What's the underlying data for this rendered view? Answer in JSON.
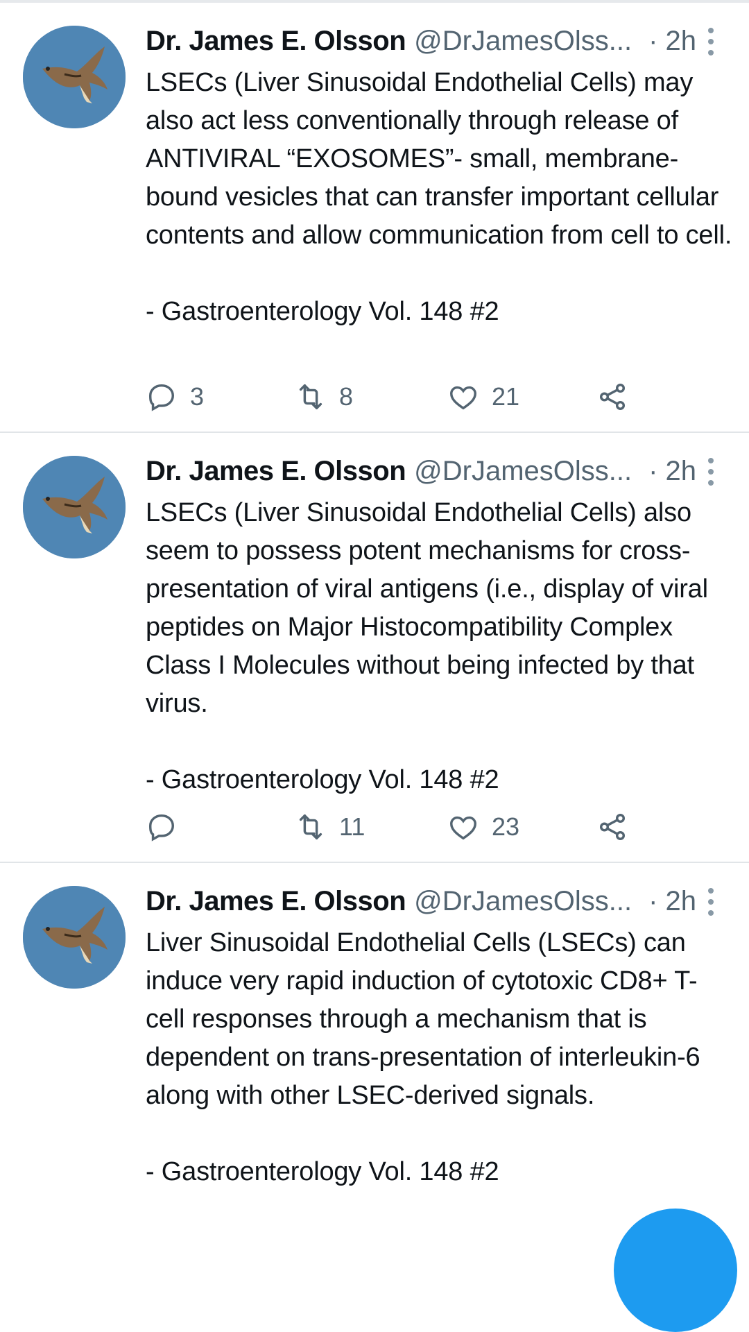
{
  "tweets": [
    {
      "author_name": "Dr. James E. Olsson",
      "author_handle": "@DrJamesOlss...",
      "time": "· 2h",
      "body": "LSECs (Liver Sinusoidal Endothelial Cells) may also act less conventionally through release of ANTIVIRAL “EXOSOMES”- small, membrane-bound vesicles that can transfer important cellular contents and allow communication from cell to cell.",
      "citation": "- Gastroenterology Vol. 148 #2",
      "reply_count": "3",
      "retweet_count": "8",
      "like_count": "21"
    },
    {
      "author_name": "Dr. James E. Olsson",
      "author_handle": "@DrJamesOlss...",
      "time": "· 2h",
      "body": "LSECs (Liver Sinusoidal Endothelial Cells) also seem to possess potent mechanisms for cross-presentation of viral antigens (i.e., display of viral peptides on Major Histocompatibility Complex Class I Molecules without being infected by that virus.",
      "citation": "- Gastroenterology Vol. 148 #2",
      "reply_count": "",
      "retweet_count": "11",
      "like_count": "23"
    },
    {
      "author_name": "Dr. James E. Olsson",
      "author_handle": "@DrJamesOlss...",
      "time": "· 2h",
      "body": "Liver Sinusoidal Endothelial Cells (LSECs) can induce very rapid induction of cytotoxic CD8+ T-cell responses through a mechanism that is dependent on trans-presentation of interleukin-6 along with other LSEC-derived signals.",
      "citation": "- Gastroenterology Vol. 148 #2"
    }
  ],
  "icons": {
    "avatar": "hawk-avatar-icon",
    "more": "more-vertical-icon",
    "reply": "reply-icon",
    "retweet": "retweet-icon",
    "like": "heart-icon",
    "share": "share-icon",
    "fab": "compose-fab"
  },
  "colors": {
    "text": "#0f1419",
    "secondary": "#536471",
    "divider": "#e1e5e8",
    "accent": "#1d9bf0",
    "avatar_sky": "#4f86b4"
  }
}
